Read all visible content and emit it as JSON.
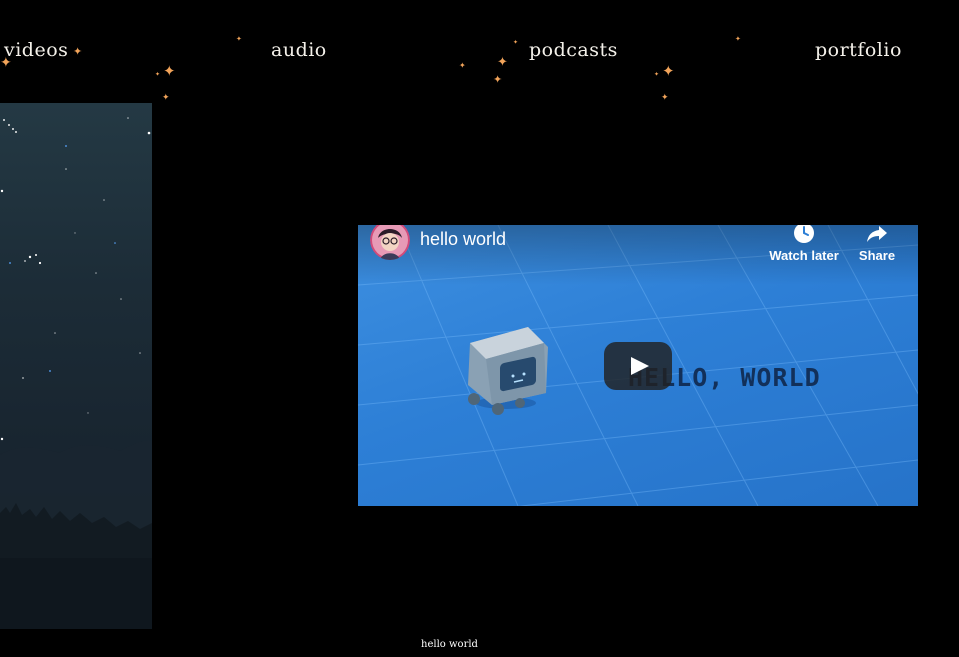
{
  "nav": {
    "items": [
      {
        "id": "videos",
        "label": "videos"
      },
      {
        "id": "audio",
        "label": "audio"
      },
      {
        "id": "podcasts",
        "label": "podcasts"
      },
      {
        "id": "portfolio",
        "label": "portfolio"
      }
    ]
  },
  "video": {
    "title": "hello world",
    "scene_text": "HELLO, WORLD",
    "watch_later_label": "Watch later",
    "share_label": "Share"
  },
  "caption": "hello world",
  "colors": {
    "background": "#000000",
    "sparkle": "#f2a45a",
    "video_blue": "#2d7fd6"
  },
  "icons": {
    "sparkles": "four-point-star",
    "watch_later": "clock-icon",
    "share": "share-arrow-icon",
    "play": "play-icon"
  }
}
